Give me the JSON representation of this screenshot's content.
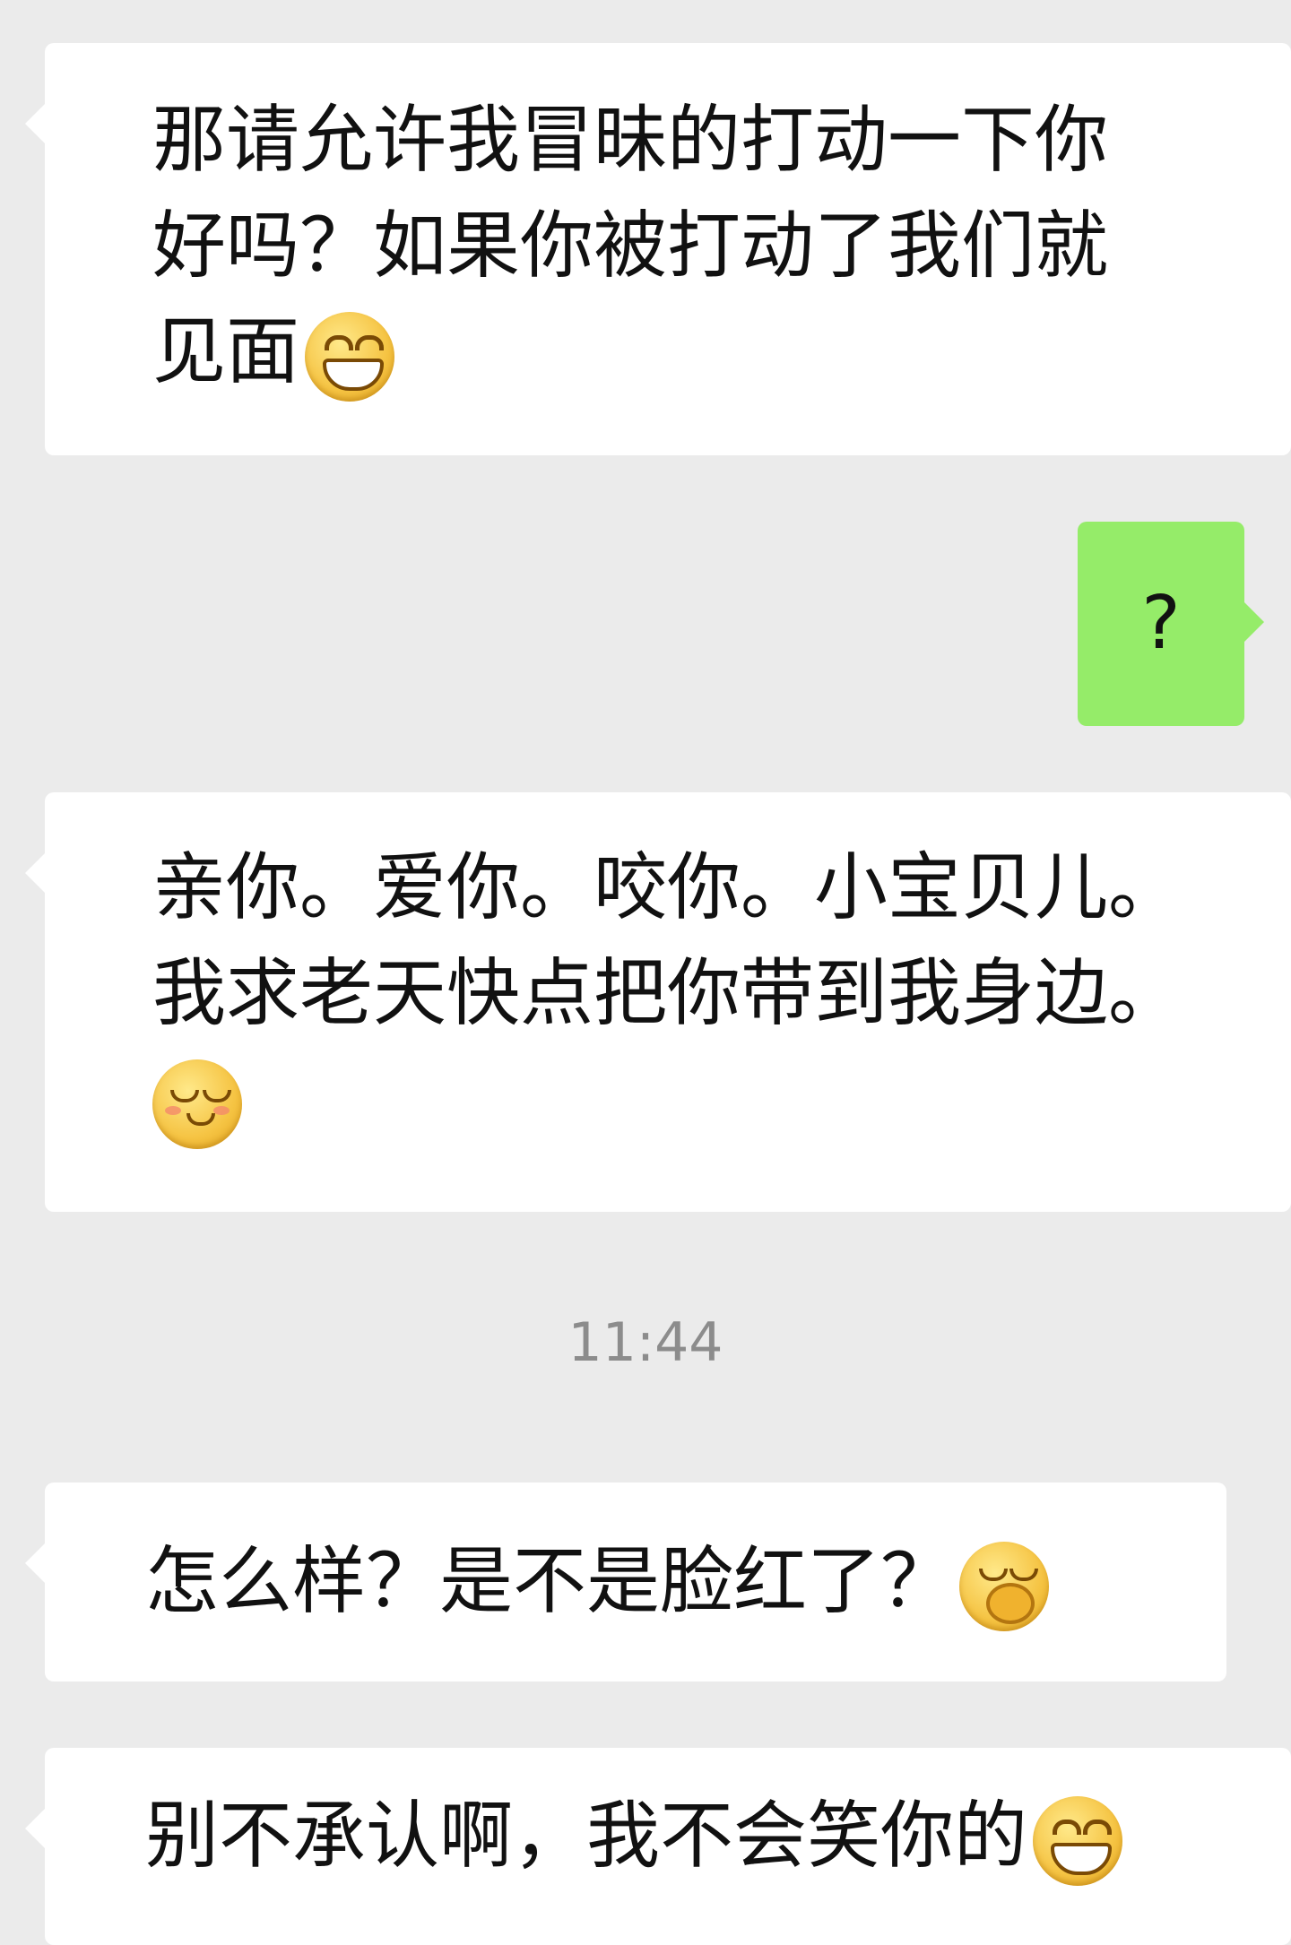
{
  "messages": [
    {
      "side": "left",
      "lines": [
        "那请允许我冒昧的打动一下你",
        "好吗？如果你被打动了我们就",
        "见面"
      ],
      "emoji": "grinning-face"
    },
    {
      "side": "right",
      "text": "?"
    },
    {
      "side": "left",
      "lines": [
        "亲你。爱你。咬你。小宝贝儿。",
        "我求老天快点把你带到我身边。"
      ],
      "emoji": "shy-face"
    },
    {
      "side": "left",
      "lines": [
        "怎么样？是不是脸红了？"
      ],
      "emoji": "covering-smile-face"
    },
    {
      "side": "left",
      "lines": [
        "别不承认啊，我不会笑你的"
      ],
      "emoji": "grinning-face"
    }
  ],
  "timestamp": "11:44",
  "colors": {
    "background": "#ebebeb",
    "incoming_bubble": "#ffffff",
    "outgoing_bubble": "#95ec69",
    "timestamp": "#8c8c8c"
  }
}
